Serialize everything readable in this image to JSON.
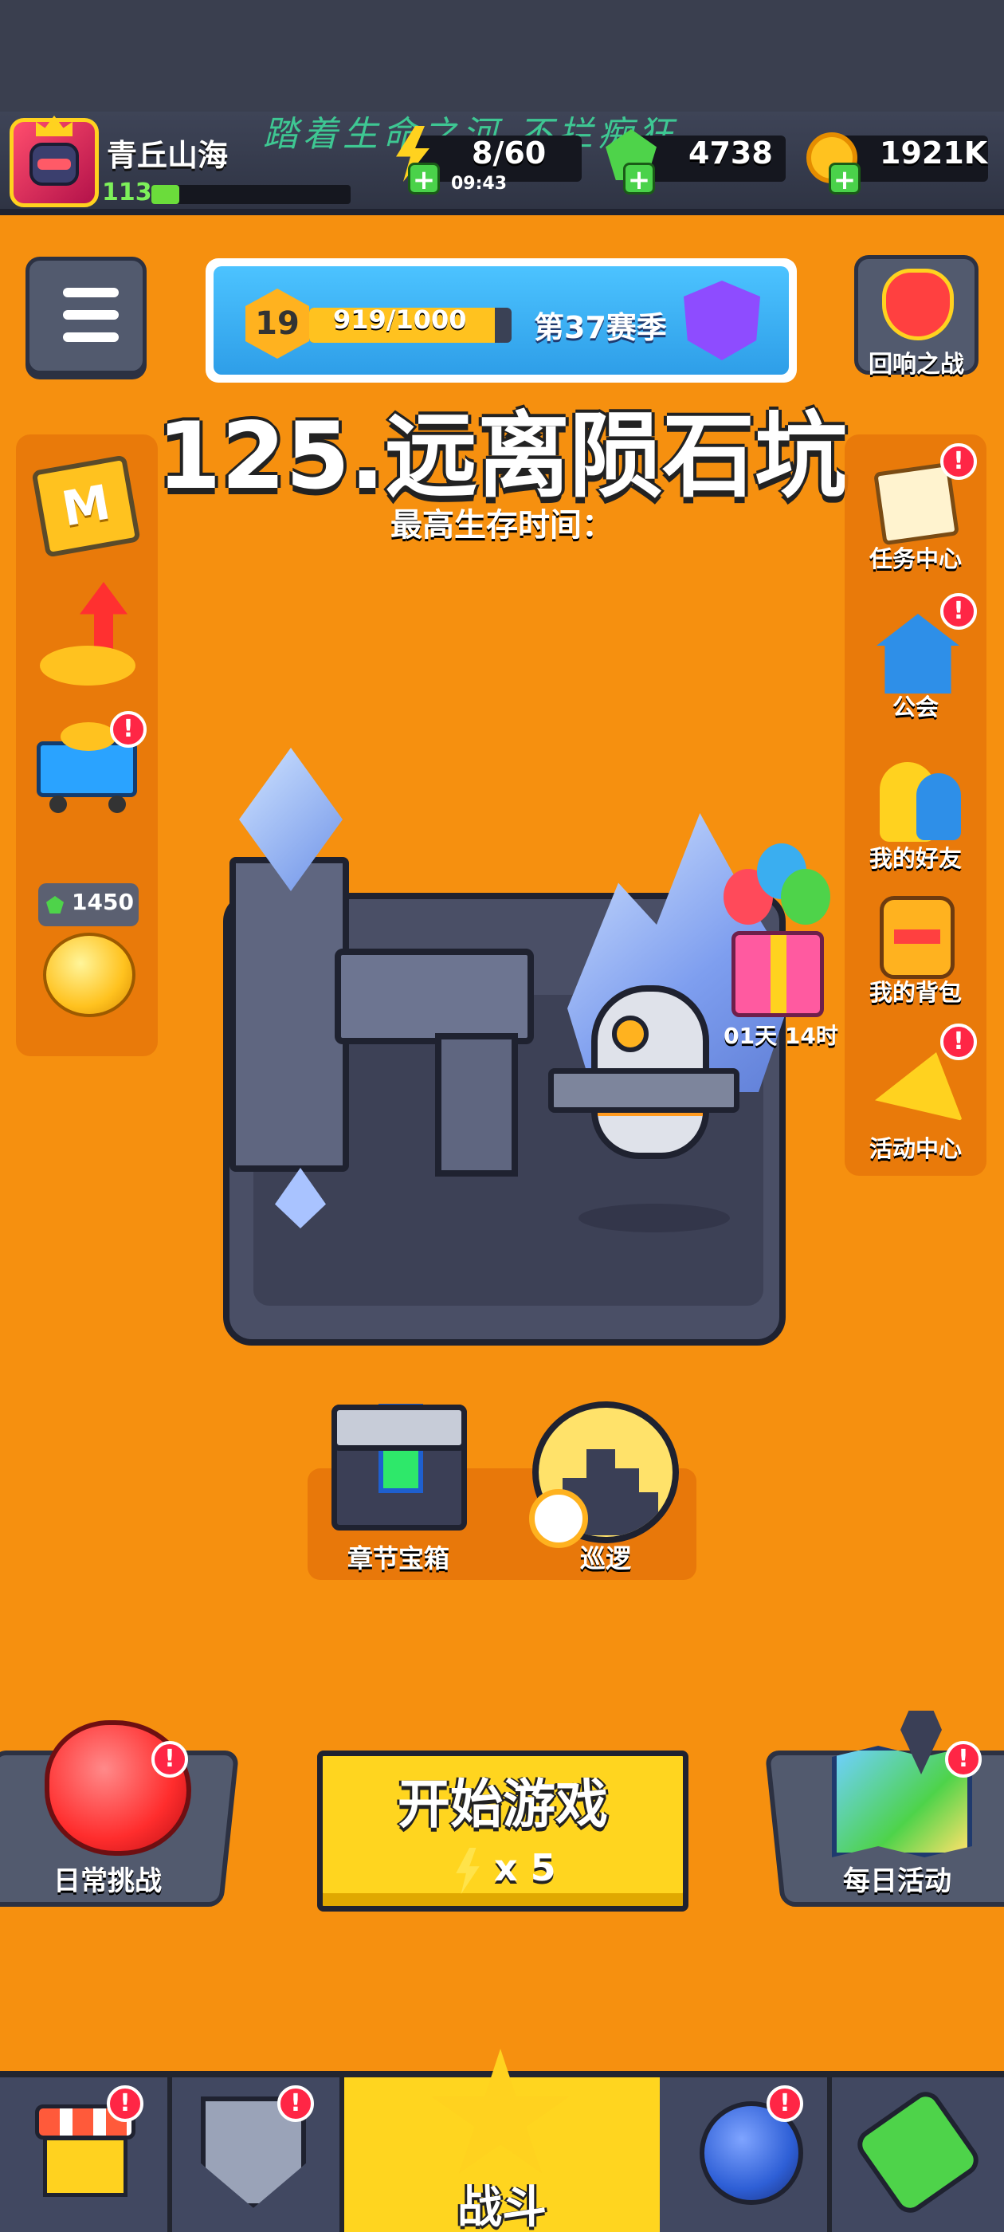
{
  "header": {
    "player_name": "青丘山海",
    "player_level": "113",
    "player_xp_fraction": 0.14,
    "slogan": "踏着生命之河 不拦痴狂",
    "energy": "8/60",
    "energy_timer": "09:43",
    "gems": "4738",
    "coins": "1921K"
  },
  "season": {
    "level": "19",
    "progress_text": "919/1000",
    "progress_fraction": 0.919,
    "name": "第37赛季"
  },
  "echo_battle": {
    "label": "回响之战"
  },
  "stage": {
    "title": "125.远离陨石坑",
    "survival_label": "最高生存时间："
  },
  "left_sidebar": {
    "lucky_count": "1450"
  },
  "right_sidebar": {
    "items": [
      {
        "label": "任务中心",
        "alert": "!"
      },
      {
        "label": "公会",
        "alert": "!"
      },
      {
        "label": "我的好友"
      },
      {
        "label": "我的背包"
      },
      {
        "label": "活动中心",
        "alert": "!"
      }
    ]
  },
  "gift": {
    "timer": "01天 14时"
  },
  "chest": {
    "label": "章节宝箱"
  },
  "patrol": {
    "label": "巡逻"
  },
  "actions": {
    "daily_challenge": "日常挑战",
    "start_game": "开始游戏",
    "start_cost": "x 5",
    "daily_activity": "每日活动",
    "alert": "!"
  },
  "bottom_nav": {
    "battle_label": "战斗",
    "alert": "!"
  },
  "colors": {
    "background": "#f6900f",
    "start_button": "#ffd51f",
    "alert": "#ff2645",
    "panel": "#525a6e"
  }
}
